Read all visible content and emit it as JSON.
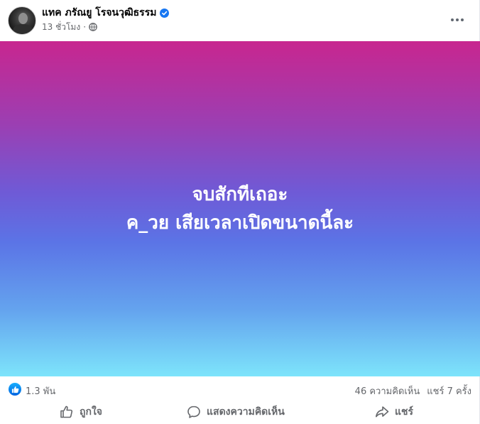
{
  "post": {
    "author": {
      "name": "แทค ภรัณยู โรจนวุฒิธรรม",
      "verified": true,
      "avatar_icon": "profile-photo"
    },
    "timestamp": "13 ชั่วโมง",
    "audience_icon": "globe-icon",
    "more_icon": "more-options-icon",
    "content": {
      "line1": "จบสักทีเถอะ",
      "line2": "ค_วย เสียเวลาเปิดขนาดนี้ละ",
      "text_color": "#ffffff",
      "background_gradient": [
        "#c8268f",
        "#6f5ad6",
        "#7de4fb"
      ]
    },
    "stats": {
      "reactions": "1.3 พัน",
      "comments": "46 ความคิดเห็น",
      "shares": "แชร์ 7 ครั้ง"
    },
    "actions": {
      "like": "ถูกใจ",
      "comment": "แสดงความคิดเห็น",
      "share": "แชร์"
    },
    "colors": {
      "accent": "#1877f2",
      "secondary_text": "#65676b"
    }
  }
}
